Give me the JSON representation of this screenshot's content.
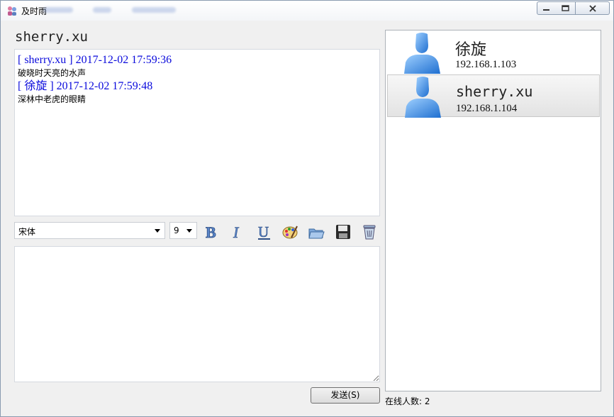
{
  "window": {
    "title": "及时雨"
  },
  "chat": {
    "peer_name": "sherry.xu",
    "messages": [
      {
        "header": "[ sherry.xu ] 2017-12-02 17:59:36",
        "body": "破晓时天亮的水声"
      },
      {
        "header": "[ 徐旋 ] 2017-12-02 17:59:48",
        "body": "深林中老虎的眼睛"
      }
    ]
  },
  "toolbar": {
    "font_family": "宋体",
    "font_size": "9",
    "icons": [
      "bold-icon",
      "italic-icon",
      "underline-icon",
      "color-palette-icon",
      "open-folder-icon",
      "save-icon",
      "clear-trash-icon"
    ]
  },
  "compose": {
    "value": ""
  },
  "send_button": {
    "label": "发送(S)"
  },
  "users": [
    {
      "name": "徐旋",
      "ip": "192.168.1.103",
      "selected": false
    },
    {
      "name": "sherry.xu",
      "ip": "192.168.1.104",
      "selected": true
    }
  ],
  "status": {
    "online_count": "在线人数: 2"
  },
  "colors": {
    "message_header": "#0a0adc",
    "avatar_blue": "#3b8fe0"
  }
}
